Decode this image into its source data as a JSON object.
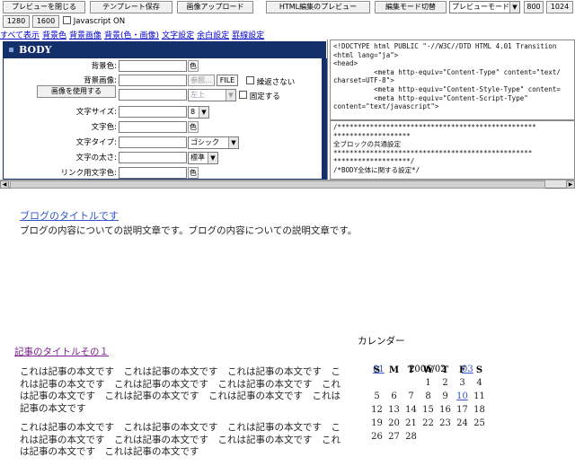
{
  "toolbar": {
    "close_preview": "プレビューを閉じる",
    "save_template": "テンプレート保存",
    "upload_image": "画像アップロード",
    "html_preview": "HTML編集のプレビュー",
    "edit_mode": "編集モード切替",
    "preview_mode": "プレビューモード",
    "w800": "800",
    "w1024": "1024",
    "w1280": "1280",
    "w1600": "1600",
    "js_label": "Javascript ON"
  },
  "links": [
    "すべて表示",
    "背景色",
    "背景画像",
    "背景(色・画像)",
    "文字設定",
    "余白設定",
    "罫線設定"
  ],
  "panel": {
    "title": "BODY",
    "bg_color_label": "背景色:",
    "bg_image_label": "背景画像:",
    "use_image_btn": "画像を使用する",
    "browse_btn": "参照...",
    "file_btn": "FILE",
    "no_repeat_label": "繰返さない",
    "position_value": "左上",
    "fixed_label": "固定する",
    "font_size_label": "文字サイズ:",
    "font_size_value": "8",
    "text_color_label": "文字色:",
    "font_type_label": "文字タイプ:",
    "font_type_value": "ゴシック",
    "font_weight_label": "文字の太さ:",
    "font_weight_value": "標準",
    "link_color_label": "リンク用文字色:",
    "color_btn": "色"
  },
  "code_top": "<!DOCTYPE html PUBLIC \"-//W3C//DTD HTML 4.01 Transition\n<html lang=\"ja\">\n<head>\n          <meta http-equiv=\"Content-Type\" content=\"text/\ncharset=UTF-8\">\n          <meta http-equiv=\"Content-Style-Type\" content=\n          <meta http-equiv=\"Content-Script-Type\"\ncontent=\"text/javascript\">",
  "code_bottom": "/*************************************************\n*******************\n全ブロックの共通設定\n*************************************************\n*******************/\n/*BODY全体に関する設定*/",
  "preview": {
    "blog_title": "ブログのタイトルです",
    "blog_desc": "ブログの内容についての説明文章です。ブログの内容についての説明文章です。",
    "entry_title": "記事のタイトルその１",
    "entry_p1": "これは記事の本文です　これは記事の本文です　これは記事の本文です　これは記事の本文です　これは記事の本文です　これは記事の本文です　これは記事の本文です　これは記事の本文です　これは記事の本文です　これは記事の本文です",
    "entry_p2": "これは記事の本文です　これは記事の本文です　これは記事の本文です　これは記事の本文です　これは記事の本文です　これは記事の本文です　これは記事の本文です　これは記事の本文です",
    "calendar_label": "カレンダー",
    "cal_prev": "01",
    "cal_month": "2006/02",
    "cal_next": "03",
    "weekdays": [
      "S",
      "M",
      "T",
      "W",
      "T",
      "F",
      "S"
    ],
    "weeks": [
      [
        "",
        "",
        "",
        "1",
        "2",
        "3",
        "4"
      ],
      [
        "5",
        "6",
        "7",
        "8",
        "9",
        "10",
        "11"
      ],
      [
        "12",
        "13",
        "14",
        "15",
        "16",
        "17",
        "18"
      ],
      [
        "19",
        "20",
        "21",
        "22",
        "23",
        "24",
        "25"
      ],
      [
        "26",
        "27",
        "28",
        "",
        "",
        "",
        ""
      ]
    ],
    "linked_day": "10"
  }
}
